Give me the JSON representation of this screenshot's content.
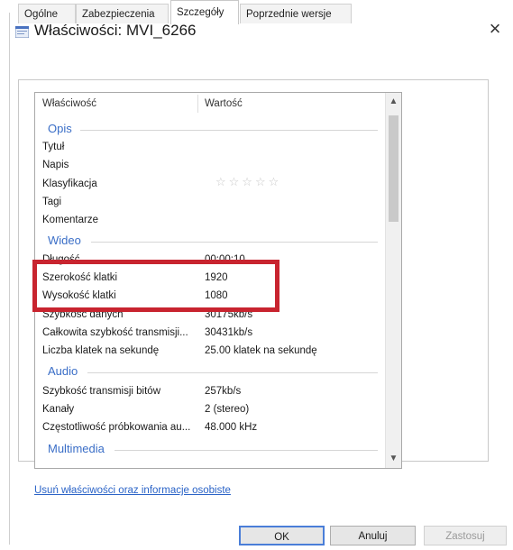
{
  "window": {
    "title": "Właściwości: MVI_6266",
    "close_glyph": "×"
  },
  "tabs": [
    {
      "label": "Ogólne"
    },
    {
      "label": "Zabezpieczenia"
    },
    {
      "label": "Szczegóły"
    },
    {
      "label": "Poprzednie wersje"
    }
  ],
  "active_tab": "Szczegóły",
  "columns": {
    "property": "Właściwość",
    "value": "Wartość"
  },
  "groups": {
    "opis": "Opis",
    "wideo": "Wideo",
    "audio": "Audio",
    "multimedia": "Multimedia"
  },
  "rows": {
    "tytul": {
      "name": "Tytuł",
      "value": ""
    },
    "napis": {
      "name": "Napis",
      "value": ""
    },
    "klasyfikacja": {
      "name": "Klasyfikacja",
      "stars": "☆☆☆☆☆",
      "rating": 0
    },
    "tagi": {
      "name": "Tagi",
      "value": ""
    },
    "komentarze": {
      "name": "Komentarze",
      "value": ""
    },
    "dlugosc": {
      "name": "Długość",
      "value": "00:00:10"
    },
    "szerokosc": {
      "name": "Szerokość klatki",
      "value": "1920"
    },
    "wysokosc": {
      "name": "Wysokość klatki",
      "value": "1080"
    },
    "szybkosc_danych": {
      "name": "Szybkość danych",
      "value": "30175kb/s"
    },
    "calkowita": {
      "name": "Całkowita szybkość transmisji...",
      "value": "30431kb/s"
    },
    "klatki": {
      "name": "Liczba klatek na sekundę",
      "value": "25.00 klatek na sekundę"
    },
    "szybkosc_bitow": {
      "name": "Szybkość transmisji bitów",
      "value": "257kb/s"
    },
    "kanaly": {
      "name": "Kanały",
      "value": "2 (stereo)"
    },
    "probkowanie": {
      "name": "Częstotliwość próbkowania au...",
      "value": "48.000 kHz"
    }
  },
  "link": "Usuń właściwości oraz informacje osobiste",
  "buttons": {
    "ok": "OK",
    "cancel": "Anuluj",
    "apply": "Zastosuj"
  },
  "colors": {
    "accent": "#3a6ec7",
    "highlight_box": "#c8242f",
    "link": "#2a63c7"
  }
}
